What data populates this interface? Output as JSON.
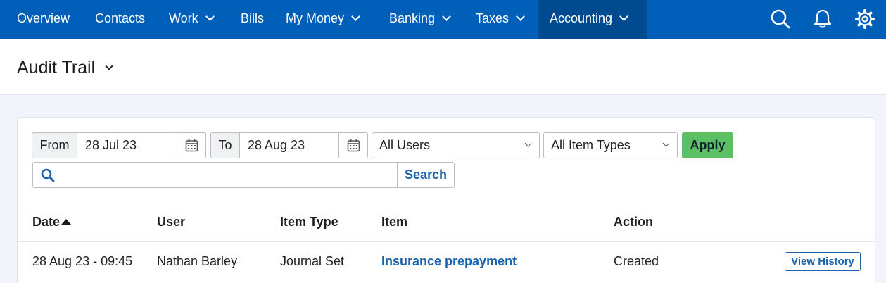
{
  "nav": {
    "items": [
      {
        "label": "Overview",
        "dropdown": false
      },
      {
        "label": "Contacts",
        "dropdown": false
      },
      {
        "label": "Work",
        "dropdown": true
      },
      {
        "label": "Bills",
        "dropdown": false
      },
      {
        "label": "My Money",
        "dropdown": true
      },
      {
        "label": "Banking",
        "dropdown": true
      },
      {
        "label": "Taxes",
        "dropdown": true
      },
      {
        "label": "Accounting",
        "dropdown": true,
        "active": true
      }
    ],
    "icons": [
      "search-icon",
      "bell-icon",
      "gear-icon"
    ],
    "colors": {
      "bar": "#0060b9",
      "active": "#004a8f"
    }
  },
  "page": {
    "title": "Audit Trail"
  },
  "filters": {
    "from_label": "From",
    "from_value": "28 Jul 23",
    "to_label": "To",
    "to_value": "28 Aug 23",
    "users_select": "All Users",
    "item_types_select": "All Item Types",
    "apply_label": "Apply",
    "search_value": "",
    "search_button": "Search"
  },
  "table": {
    "headers": {
      "date": "Date",
      "user": "User",
      "item_type": "Item Type",
      "item": "Item",
      "action": "Action"
    },
    "sort": {
      "column": "date",
      "direction": "ascending"
    },
    "rows": [
      {
        "date": "28 Aug 23 - 09:45",
        "user": "Nathan Barley",
        "item_type": "Journal Set",
        "item": "Insurance prepayment",
        "action": "Created",
        "button": "View History"
      }
    ]
  },
  "colors": {
    "apply": "#5cbf63",
    "link": "#1a64ad"
  }
}
